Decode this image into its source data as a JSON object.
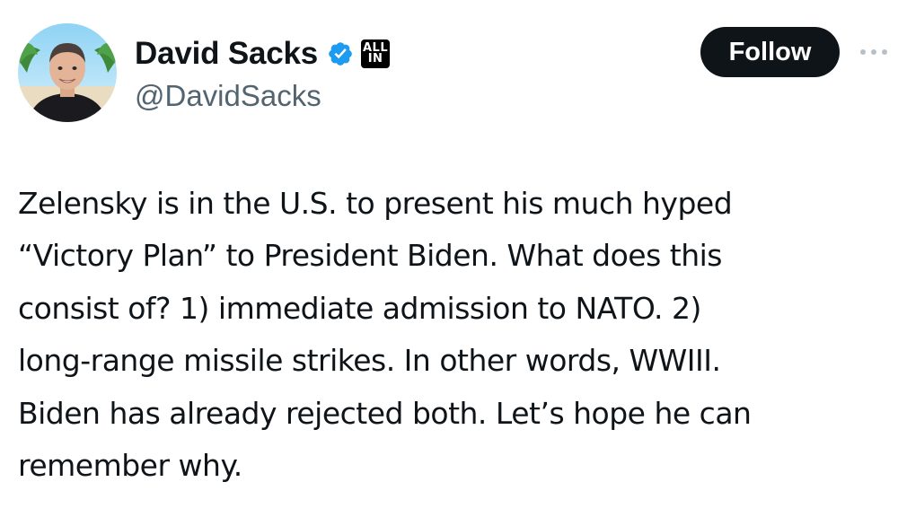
{
  "author": {
    "display_name": "David Sacks",
    "handle": "@DavidSacks",
    "verified_icon": "verified-badge-icon",
    "affiliate_badge": {
      "line1": "ALL",
      "line2": "IN"
    }
  },
  "actions": {
    "follow_label": "Follow",
    "more_icon": "more-options-icon"
  },
  "tweet": {
    "lines": [
      "Zelensky is in the U.S. to present his much hyped",
      "“Victory Plan” to President Biden. What does this",
      "consist of? 1) immediate admission to NATO. 2)",
      "long-range missile strikes. In other words, WWIII.",
      "Biden has already rejected both. Let’s hope he can",
      "remember why."
    ]
  },
  "colors": {
    "text_primary": "#0f1419",
    "text_secondary": "#536471",
    "verified_blue": "#1d9bf0",
    "follow_bg": "#0f1419"
  }
}
